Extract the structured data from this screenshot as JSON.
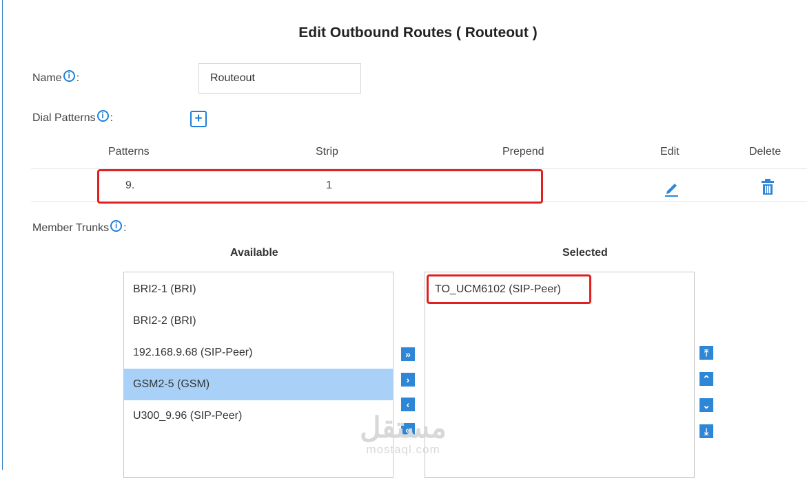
{
  "title": "Edit Outbound Routes ( Routeout )",
  "name": {
    "label": "Name",
    "info_glyph": "i",
    "suffix": ":",
    "value": "Routeout"
  },
  "dial_patterns": {
    "label": "Dial Patterns",
    "suffix": ":",
    "add_glyph": "+",
    "columns": [
      "Patterns",
      "Strip",
      "Prepend",
      "Edit",
      "Delete"
    ],
    "rows": [
      {
        "pattern": "9.",
        "strip": "1",
        "prepend": ""
      }
    ]
  },
  "member_trunks": {
    "label": "Member Trunks",
    "suffix": ":",
    "available_title": "Available",
    "selected_title": "Selected",
    "available": [
      "BRI2-1 (BRI)",
      "BRI2-2 (BRI)",
      "192.168.9.68 (SIP-Peer)",
      "GSM2-5 (GSM)",
      "U300_9.96 (SIP-Peer)"
    ],
    "available_selected_index": 3,
    "selected": [
      "TO_UCM6102 (SIP-Peer)"
    ]
  },
  "move_buttons": {
    "all_right": "»",
    "right": "›",
    "left": "‹",
    "all_left": "«"
  },
  "order_buttons": {
    "top": "⤒",
    "up": "⌃",
    "down": "⌄",
    "bottom": "⤓"
  },
  "watermark": {
    "arabic": "مستقل",
    "latin": "mostaql.com"
  },
  "colors": {
    "accent": "#2d86d6",
    "highlight": "#e02020",
    "selection": "#a9d1f7"
  },
  "icons": {
    "info": "info-icon",
    "add": "plus-icon",
    "edit": "pencil-icon",
    "delete": "trash-icon"
  }
}
